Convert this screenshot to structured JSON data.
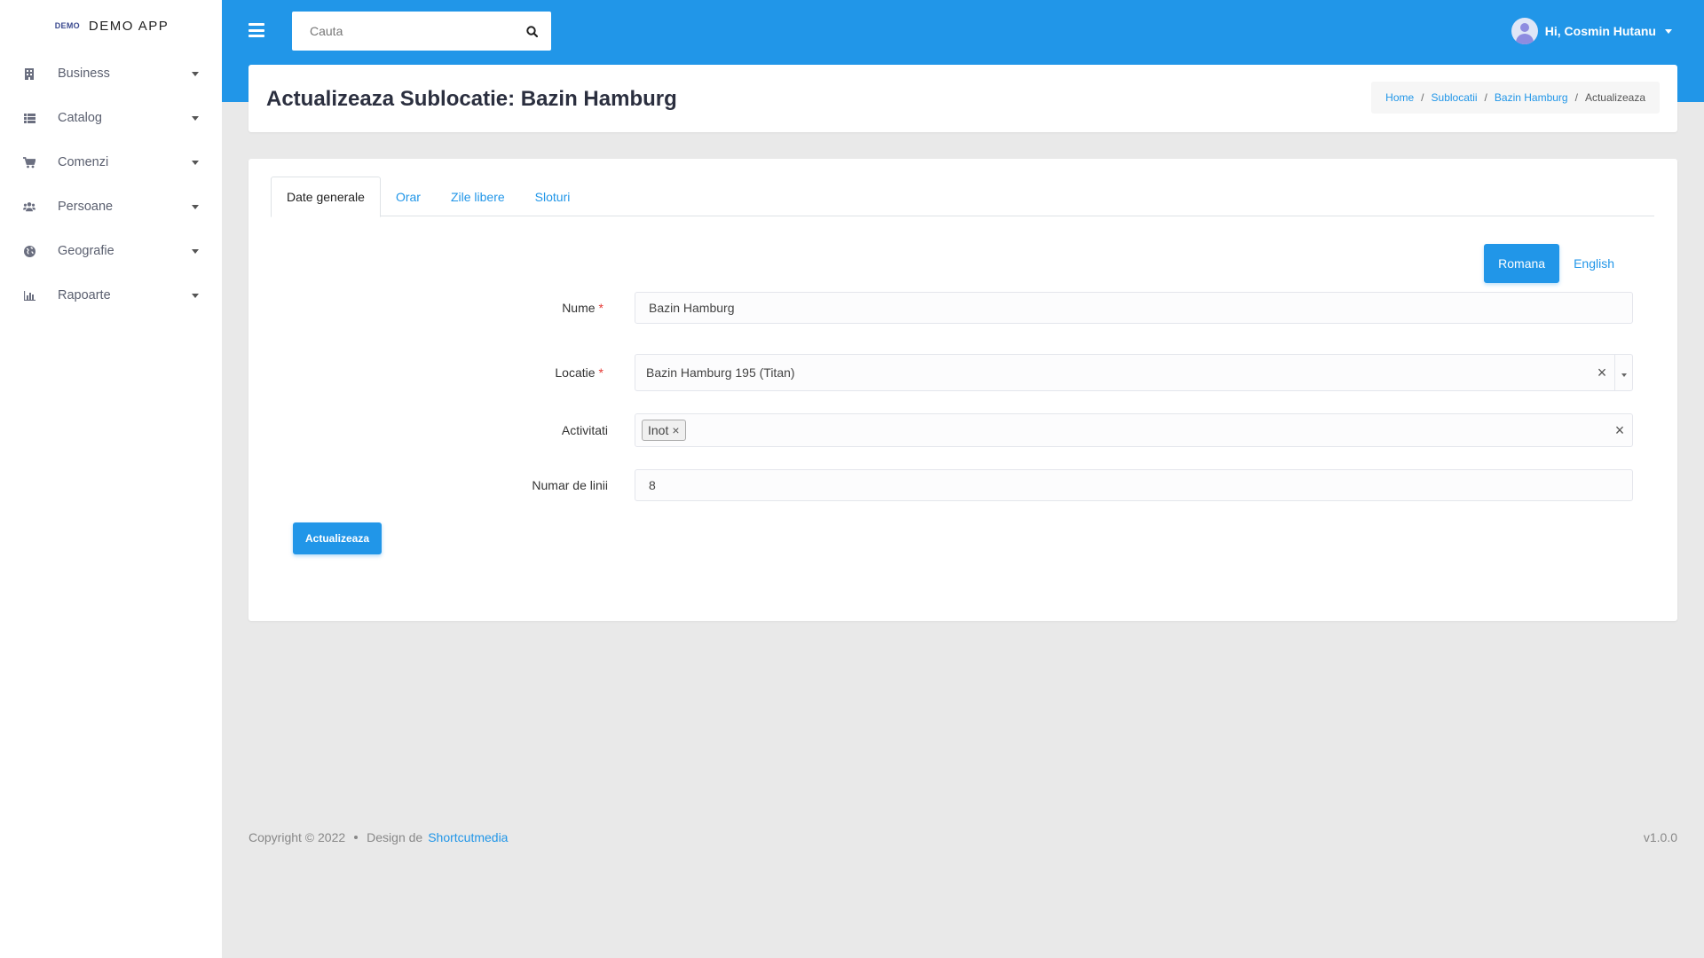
{
  "brand": {
    "logo": "DEMO",
    "name": "DEMO APP"
  },
  "sidebar": {
    "items": [
      {
        "label": "Business",
        "icon": "building-icon"
      },
      {
        "label": "Catalog",
        "icon": "list-icon"
      },
      {
        "label": "Comenzi",
        "icon": "cart-icon"
      },
      {
        "label": "Persoane",
        "icon": "users-icon"
      },
      {
        "label": "Geografie",
        "icon": "globe-icon"
      },
      {
        "label": "Rapoarte",
        "icon": "chart-icon"
      }
    ]
  },
  "topbar": {
    "search_placeholder": "Cauta",
    "user_greeting": "Hi, Cosmin Hutanu"
  },
  "header": {
    "title": "Actualizeaza Sublocatie: Bazin Hamburg",
    "breadcrumb": [
      "Home",
      "Sublocatii",
      "Bazin Hamburg",
      "Actualizeaza"
    ]
  },
  "tabs": [
    "Date generale",
    "Orar",
    "Zile libere",
    "Sloturi"
  ],
  "languages": {
    "active": "Romana",
    "other": "English"
  },
  "form": {
    "nume": {
      "label": "Nume",
      "value": "Bazin Hamburg"
    },
    "locatie": {
      "label": "Locatie",
      "value": "Bazin Hamburg 195 (Titan)"
    },
    "activitati": {
      "label": "Activitati",
      "tags": [
        "Inot"
      ]
    },
    "numar_linii": {
      "label": "Numar de linii",
      "value": "8"
    },
    "submit_label": "Actualizeaza"
  },
  "footer": {
    "copyright": "Copyright © 2022",
    "design_prefix": "Design de",
    "design_link": "Shortcutmedia",
    "version": "v1.0.0"
  },
  "colors": {
    "primary": "#2196e8",
    "required": "#e53935",
    "background": "#e9e9e9"
  }
}
